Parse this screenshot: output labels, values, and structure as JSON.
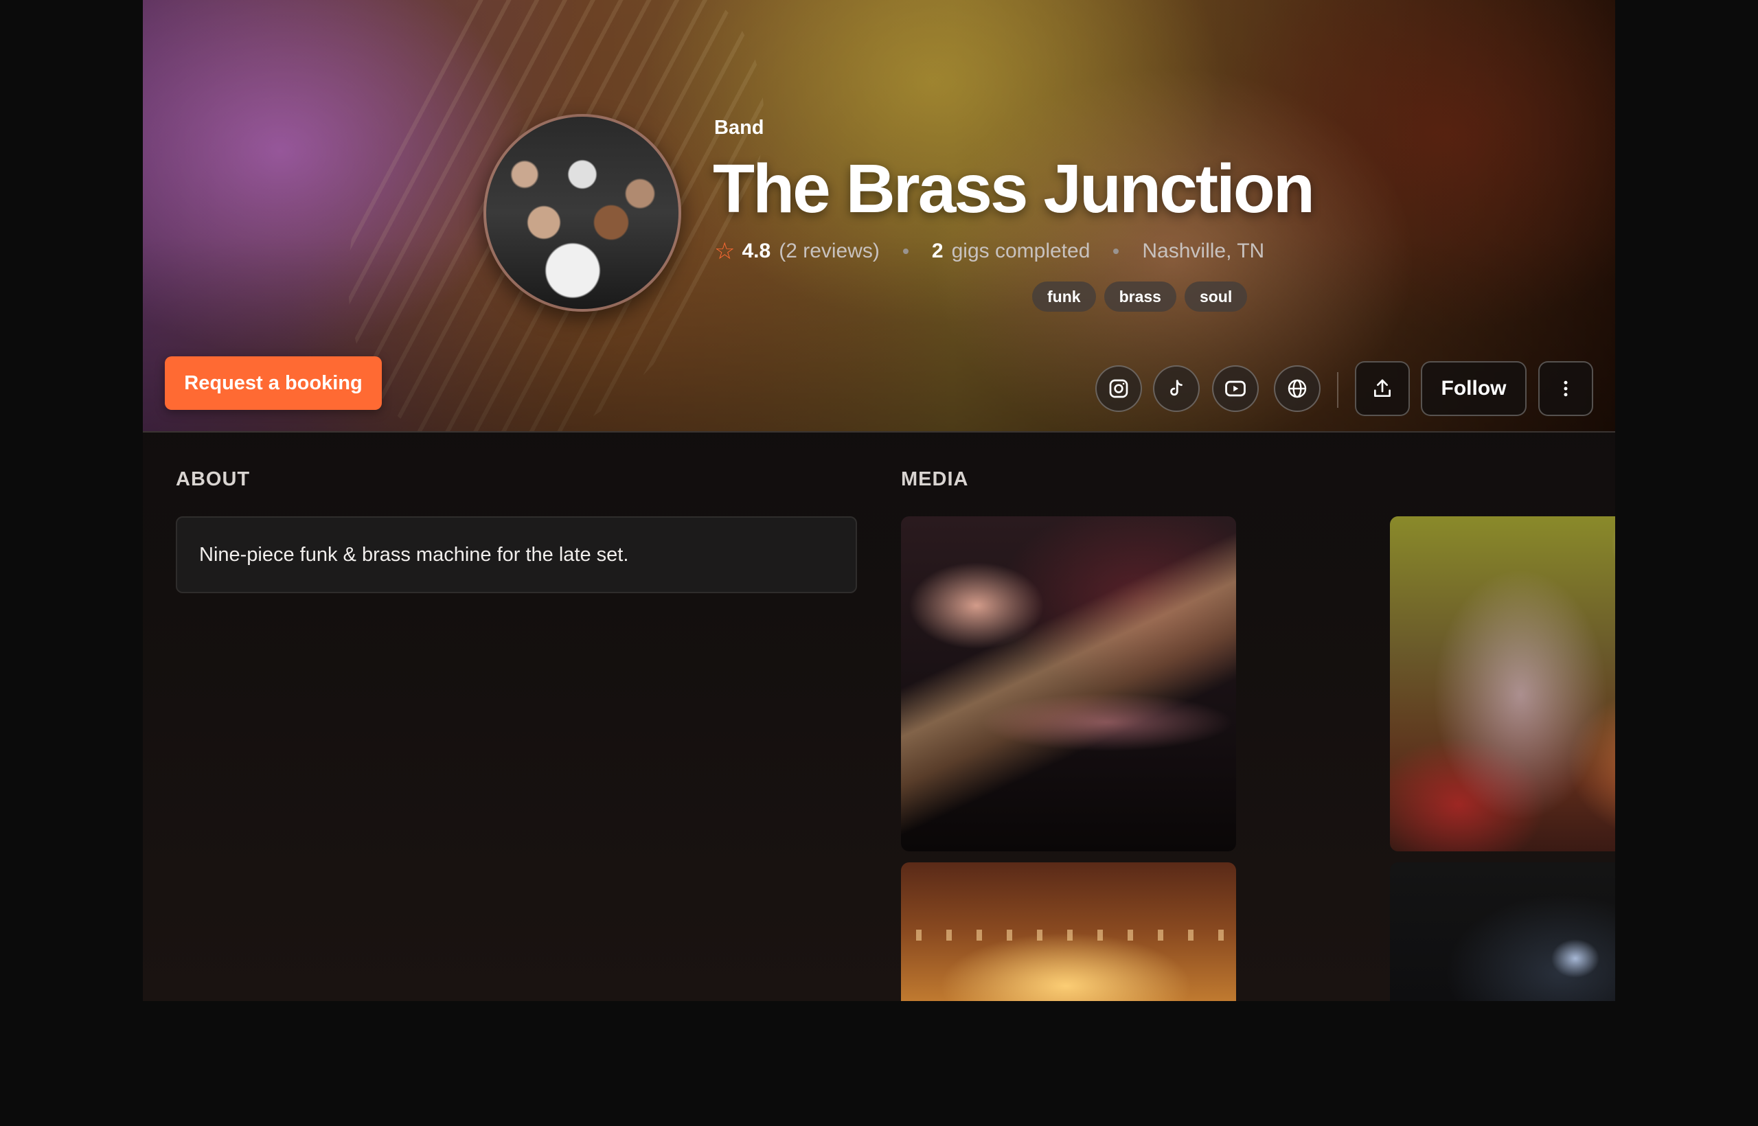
{
  "profile": {
    "type_label": "Band",
    "name": "The Brass Junction",
    "rating": "4.8",
    "reviews": "(2 reviews)",
    "gigs_count": "2",
    "gigs_label": "gigs completed",
    "location": "Nashville, TN",
    "tags": [
      "funk",
      "brass",
      "soul"
    ]
  },
  "actions": {
    "request_booking": "Request a booking",
    "follow": "Follow"
  },
  "social_icons": [
    "instagram-icon",
    "tiktok-icon",
    "youtube-icon",
    "globe-icon"
  ],
  "about": {
    "title": "ABOUT",
    "text": "Nine-piece funk & brass machine for the late set."
  },
  "media": {
    "title": "MEDIA",
    "items": [
      "trumpet-photo",
      "saxophone-photo",
      "stage-lights-photo",
      "dark-stage-photo"
    ]
  },
  "colors": {
    "accent": "#ff6a33",
    "background": "#0b0b0b",
    "panel": "#1c1b1b"
  }
}
